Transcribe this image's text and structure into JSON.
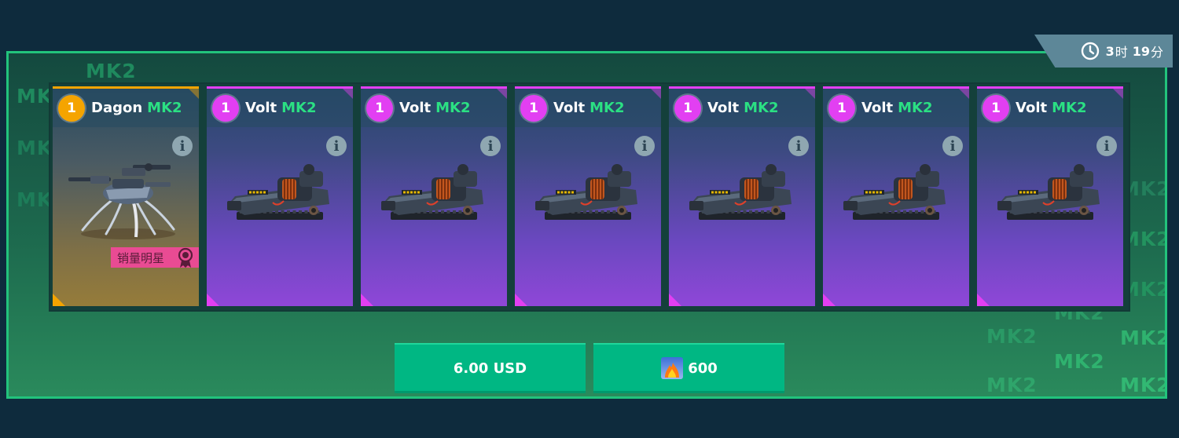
{
  "timer": {
    "hours": "3",
    "hours_unit": "时",
    "minutes": "19",
    "minutes_unit": "分",
    "icon": "clock-icon"
  },
  "watermark_text": "MK2",
  "cards": [
    {
      "level": "1",
      "name": "Dagon",
      "mark": "MK2",
      "rarity": "legendary",
      "accent": "#f5a400",
      "item": "robot"
    },
    {
      "level": "1",
      "name": "Volt",
      "mark": "MK2",
      "rarity": "epic",
      "accent": "#e23ff2",
      "item": "weapon"
    },
    {
      "level": "1",
      "name": "Volt",
      "mark": "MK2",
      "rarity": "epic",
      "accent": "#e23ff2",
      "item": "weapon"
    },
    {
      "level": "1",
      "name": "Volt",
      "mark": "MK2",
      "rarity": "epic",
      "accent": "#e23ff2",
      "item": "weapon"
    },
    {
      "level": "1",
      "name": "Volt",
      "mark": "MK2",
      "rarity": "epic",
      "accent": "#e23ff2",
      "item": "weapon"
    },
    {
      "level": "1",
      "name": "Volt",
      "mark": "MK2",
      "rarity": "epic",
      "accent": "#e23ff2",
      "item": "weapon"
    },
    {
      "level": "1",
      "name": "Volt",
      "mark": "MK2",
      "rarity": "epic",
      "accent": "#e23ff2",
      "item": "weapon"
    }
  ],
  "badge": {
    "label": "销量明星",
    "icon": "medal-icon"
  },
  "buttons": {
    "price_usd": "6.00 USD",
    "price_gold": "600",
    "gold_icon": "gold-currency-icon"
  },
  "colors": {
    "panel_border": "#22c37c",
    "button": "#00b783",
    "mk2": "#2be083"
  }
}
